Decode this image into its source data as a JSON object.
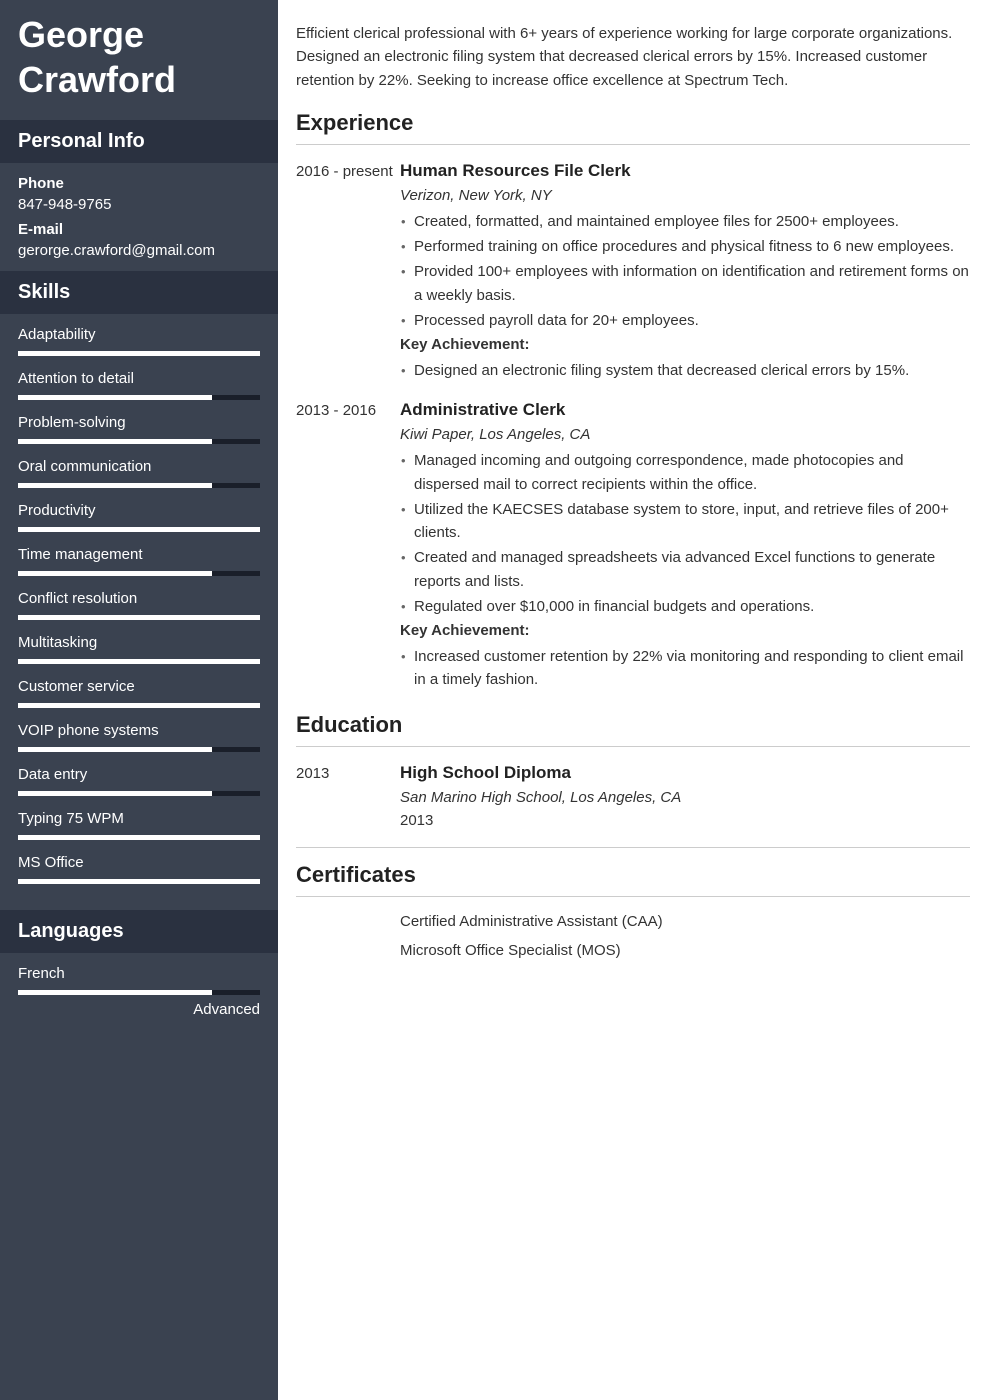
{
  "name": "George Crawford",
  "sidebar": {
    "personal_info_heading": "Personal Info",
    "phone_label": "Phone",
    "phone_value": "847-948-9765",
    "email_label": "E-mail",
    "email_value": "gerorge.crawford@gmail.com",
    "skills_heading": "Skills",
    "skills": [
      {
        "name": "Adaptability",
        "pct": 100
      },
      {
        "name": "Attention to detail",
        "pct": 80
      },
      {
        "name": "Problem-solving",
        "pct": 80
      },
      {
        "name": "Oral communication",
        "pct": 80
      },
      {
        "name": "Productivity",
        "pct": 100
      },
      {
        "name": "Time management",
        "pct": 80
      },
      {
        "name": "Conflict resolution",
        "pct": 100
      },
      {
        "name": "Multitasking",
        "pct": 100
      },
      {
        "name": "Customer service",
        "pct": 100
      },
      {
        "name": "VOIP phone systems",
        "pct": 80
      },
      {
        "name": "Data entry",
        "pct": 80
      },
      {
        "name": "Typing 75 WPM",
        "pct": 100
      },
      {
        "name": "MS Office",
        "pct": 100
      }
    ],
    "languages_heading": "Languages",
    "languages": [
      {
        "name": "French",
        "pct": 80,
        "level": "Advanced"
      }
    ]
  },
  "summary": "Efficient clerical professional with 6+ years of experience working for large corporate organizations. Designed an electronic filing system that decreased clerical errors by 15%. Increased customer retention by 22%. Seeking to increase office excellence at Spectrum Tech.",
  "headings": {
    "experience": "Experience",
    "education": "Education",
    "certificates": "Certificates"
  },
  "experience": [
    {
      "date": "2016 - present",
      "title": "Human Resources File Clerk",
      "sub": "Verizon, New York, NY",
      "bullets": [
        "Created, formatted, and maintained employee files for 2500+ employees.",
        "Performed training on office procedures and physical fitness to 6 new employees.",
        "Provided 100+ employees with information on identification and retirement forms on a weekly basis.",
        "Processed payroll data for 20+ employees."
      ],
      "key_label": "Key Achievement:",
      "key_bullets": [
        "Designed an electronic filing system that decreased clerical errors by 15%."
      ]
    },
    {
      "date": "2013 - 2016",
      "title": "Administrative Clerk",
      "sub": "Kiwi Paper, Los Angeles, CA",
      "bullets": [
        "Managed incoming and outgoing correspondence, made photocopies and dispersed mail to correct recipients within the office.",
        "Utilized the KAECSES database system to store, input, and retrieve files of 200+ clients.",
        "Created and managed spreadsheets via advanced Excel functions to generate reports and lists.",
        "Regulated over $10,000 in financial budgets and operations."
      ],
      "key_label": "Key Achievement:",
      "key_bullets": [
        "Increased customer retention by 22% via monitoring and responding to client email in a timely fashion."
      ]
    }
  ],
  "education": [
    {
      "date": "2013",
      "title": "High School Diploma",
      "sub": "San Marino High School, Los Angeles, CA",
      "year": "2013"
    }
  ],
  "certificates": [
    "Certified Administrative Assistant (CAA)",
    "Microsoft Office Specialist (MOS)"
  ]
}
